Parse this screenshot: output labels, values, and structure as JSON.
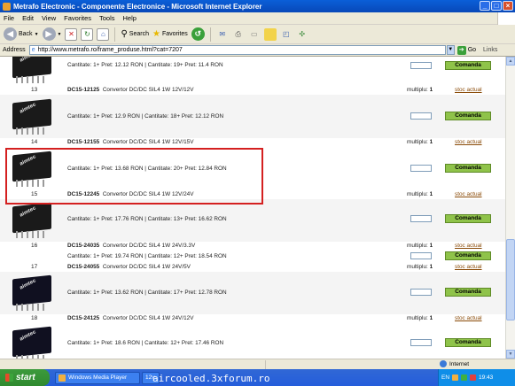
{
  "window": {
    "title": "Metrafo Electronic - Componente Electronice - Microsoft Internet Explorer"
  },
  "menu": [
    "File",
    "Edit",
    "View",
    "Favorites",
    "Tools",
    "Help"
  ],
  "toolbar": {
    "back": "Back",
    "search": "Search",
    "favorites": "Favorites"
  },
  "address": {
    "label": "Address",
    "url": "http://www.metrafo.ro/frame_produse.html?cat=7207",
    "go": "Go",
    "links": "Links"
  },
  "products": [
    {
      "price_line": "Cantitate: 1+ Pret: 12.12 RON | Cantitate: 19+ Pret: 11.4 RON",
      "button": "Comanda"
    },
    {
      "index": "13",
      "code": "DC15-12125",
      "desc": "Convertor DC/DC SIL4 1W 12V/12V",
      "mult_label": "multiplu:",
      "mult": "1",
      "stoc": "stoc actual",
      "price_line": "Cantitate: 1+ Pret: 12.9 RON | Cantitate: 18+ Pret: 12.12 RON",
      "button": "Comanda"
    },
    {
      "index": "14",
      "code": "DC15-12155",
      "desc": "Convertor DC/DC SIL4 1W 12V/15V",
      "mult_label": "multiplu:",
      "mult": "1",
      "stoc": "stoc actual",
      "price_line": "Cantitate: 1+ Pret: 13.68 RON | Cantitate: 20+ Pret: 12.84 RON",
      "button": "Comanda"
    },
    {
      "index": "15",
      "code": "DC15-12245",
      "desc": "Convertor DC/DC SIL4 1W 12V/24V",
      "mult_label": "multiplu:",
      "mult": "1",
      "stoc": "stoc actual",
      "price_line": "Cantitate: 1+ Pret: 17.76 RON | Cantitate: 13+ Pret: 16.62 RON",
      "button": "Comanda"
    },
    {
      "index": "16",
      "code": "DC15-24035",
      "desc": "Convertor DC/DC SIL4 1W 24V/3.3V",
      "mult_label": "multiplu:",
      "mult": "1",
      "stoc": "stoc actual",
      "price_line": "Cantitate: 1+ Pret: 19.74 RON | Cantitate: 12+ Pret: 18.54 RON",
      "button": "Comanda"
    },
    {
      "index": "17",
      "code": "DC15-24055",
      "desc": "Convertor DC/DC SIL4 1W 24V/5V",
      "mult_label": "multiplu:",
      "mult": "1",
      "stoc": "stoc actual",
      "price_line": "Cantitate: 1+ Pret: 13.62 RON | Cantitate: 17+ Pret: 12.78 RON",
      "button": "Comanda"
    },
    {
      "index": "18",
      "code": "DC15-24125",
      "desc": "Convertor DC/DC SIL4 1W 24V/12V",
      "mult_label": "multiplu:",
      "mult": "1",
      "stoc": "stoc actual",
      "price_line": "Cantitate: 1+ Pret: 18.6 RON | Cantitate: 12+ Pret: 17.46 RON",
      "button": "Comanda"
    }
  ],
  "status": {
    "zone": "Internet"
  },
  "taskbar": {
    "start": "start",
    "tasks": [
      "Windows Media Player",
      "12v"
    ],
    "watermark": "aircooled.3xforum.ro",
    "lang": "EN",
    "clock": "19:43"
  }
}
